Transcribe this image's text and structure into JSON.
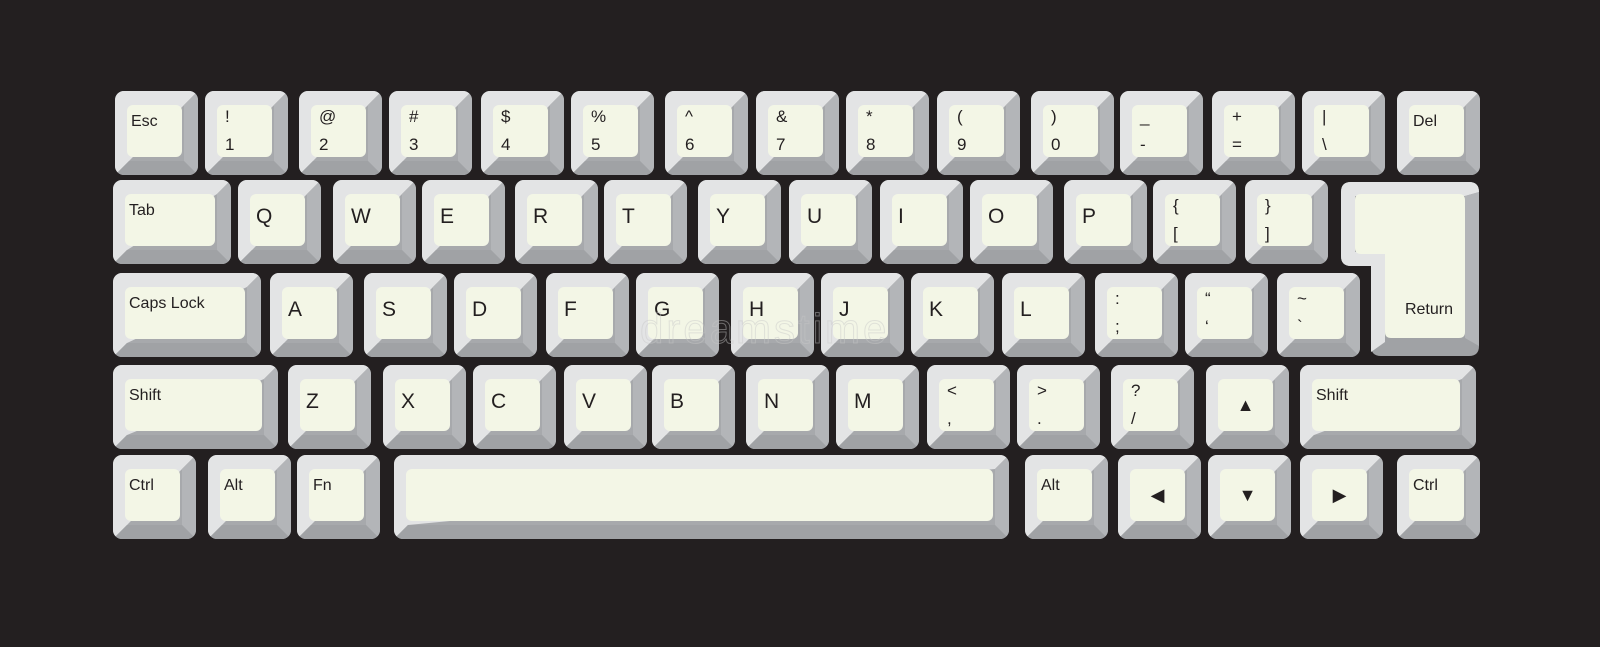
{
  "keyboard": {
    "colors": {
      "background": "#231f20",
      "key_face": "#f3f6e6",
      "bevel_top": "#e3e4e5",
      "bevel_right": "#b3b5b8",
      "bevel_bottom": "#a0a2a5",
      "legend": "#231f20"
    },
    "watermark": "dreamstime",
    "rows": [
      [
        {
          "id": "esc",
          "type": "word",
          "label": "Esc"
        },
        {
          "id": "1",
          "type": "dual",
          "top": "!",
          "bottom": "1"
        },
        {
          "id": "2",
          "type": "dual",
          "top": "@",
          "bottom": "2"
        },
        {
          "id": "3",
          "type": "dual",
          "top": "#",
          "bottom": "3"
        },
        {
          "id": "4",
          "type": "dual",
          "top": "$",
          "bottom": "4"
        },
        {
          "id": "5",
          "type": "dual",
          "top": "%",
          "bottom": "5"
        },
        {
          "id": "6",
          "type": "dual",
          "top": "^",
          "bottom": "6"
        },
        {
          "id": "7",
          "type": "dual",
          "top": "&",
          "bottom": "7"
        },
        {
          "id": "8",
          "type": "dual",
          "top": "*",
          "bottom": "8"
        },
        {
          "id": "9",
          "type": "dual",
          "top": "(",
          "bottom": "9"
        },
        {
          "id": "0",
          "type": "dual",
          "top": ")",
          "bottom": "0"
        },
        {
          "id": "minus",
          "type": "dual",
          "top": "_",
          "bottom": "-"
        },
        {
          "id": "equals",
          "type": "dual",
          "top": "+",
          "bottom": "="
        },
        {
          "id": "backslash",
          "type": "dual",
          "top": "|",
          "bottom": "\\"
        },
        {
          "id": "del",
          "type": "word",
          "label": "Del"
        }
      ],
      [
        {
          "id": "tab",
          "type": "word",
          "label": "Tab"
        },
        {
          "id": "q",
          "type": "main",
          "label": "Q"
        },
        {
          "id": "w",
          "type": "main",
          "label": "W"
        },
        {
          "id": "e",
          "type": "main",
          "label": "E"
        },
        {
          "id": "r",
          "type": "main",
          "label": "R"
        },
        {
          "id": "t",
          "type": "main",
          "label": "T"
        },
        {
          "id": "y",
          "type": "main",
          "label": "Y"
        },
        {
          "id": "u",
          "type": "main",
          "label": "U"
        },
        {
          "id": "i",
          "type": "main",
          "label": "I"
        },
        {
          "id": "o",
          "type": "main",
          "label": "O"
        },
        {
          "id": "p",
          "type": "main",
          "label": "P"
        },
        {
          "id": "lbracket",
          "type": "dual",
          "top": "{",
          "bottom": "["
        },
        {
          "id": "rbracket",
          "type": "dual",
          "top": "}",
          "bottom": "]"
        }
      ],
      [
        {
          "id": "capslock",
          "type": "word",
          "label": "Caps Lock"
        },
        {
          "id": "a",
          "type": "main",
          "label": "A"
        },
        {
          "id": "s",
          "type": "main",
          "label": "S"
        },
        {
          "id": "d",
          "type": "main",
          "label": "D"
        },
        {
          "id": "f",
          "type": "main",
          "label": "F"
        },
        {
          "id": "g",
          "type": "main",
          "label": "G"
        },
        {
          "id": "h",
          "type": "main",
          "label": "H"
        },
        {
          "id": "j",
          "type": "main",
          "label": "J"
        },
        {
          "id": "k",
          "type": "main",
          "label": "K"
        },
        {
          "id": "l",
          "type": "main",
          "label": "L"
        },
        {
          "id": "semicolon",
          "type": "dual",
          "top": ":",
          "bottom": ";"
        },
        {
          "id": "quote",
          "type": "dual",
          "top": "“",
          "bottom": "‘"
        },
        {
          "id": "backtick",
          "type": "dual",
          "top": "~",
          "bottom": "`"
        }
      ],
      [
        {
          "id": "shift-left",
          "type": "word",
          "label": "Shift"
        },
        {
          "id": "z",
          "type": "main",
          "label": "Z"
        },
        {
          "id": "x",
          "type": "main",
          "label": "X"
        },
        {
          "id": "c",
          "type": "main",
          "label": "C"
        },
        {
          "id": "v",
          "type": "main",
          "label": "V"
        },
        {
          "id": "b",
          "type": "main",
          "label": "B"
        },
        {
          "id": "n",
          "type": "main",
          "label": "N"
        },
        {
          "id": "m",
          "type": "main",
          "label": "M"
        },
        {
          "id": "comma",
          "type": "dual",
          "top": "<",
          "bottom": ","
        },
        {
          "id": "period",
          "type": "dual",
          "top": ">",
          "bottom": "."
        },
        {
          "id": "slash",
          "type": "dual",
          "top": "?",
          "bottom": "/"
        },
        {
          "id": "arrow-up",
          "type": "arrow",
          "label": "▲",
          "icon": "arrow-up-icon"
        },
        {
          "id": "shift-right",
          "type": "word",
          "label": "Shift"
        }
      ],
      [
        {
          "id": "ctrl-left",
          "type": "word",
          "label": "Ctrl"
        },
        {
          "id": "alt-left",
          "type": "word",
          "label": "Alt"
        },
        {
          "id": "fn",
          "type": "word",
          "label": "Fn"
        },
        {
          "id": "space",
          "type": "blank",
          "label": ""
        },
        {
          "id": "alt-right",
          "type": "word",
          "label": "Alt"
        },
        {
          "id": "arrow-left",
          "type": "arrow",
          "label": "◀",
          "icon": "arrow-left-icon"
        },
        {
          "id": "arrow-down",
          "type": "arrow",
          "label": "▼",
          "icon": "arrow-down-icon"
        },
        {
          "id": "arrow-right",
          "type": "arrow",
          "label": "▶",
          "icon": "arrow-right-icon"
        },
        {
          "id": "ctrl-right",
          "type": "word",
          "label": "Ctrl"
        }
      ]
    ],
    "return_key": {
      "id": "return",
      "type": "return",
      "label": "Return"
    }
  }
}
